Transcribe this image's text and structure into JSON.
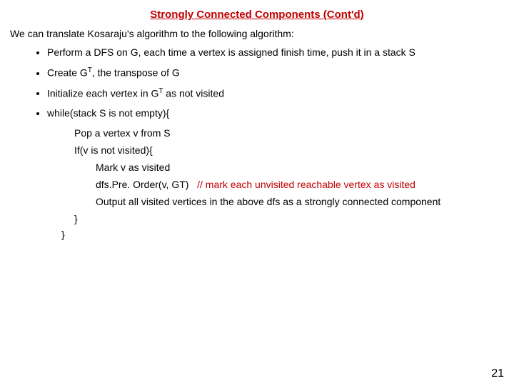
{
  "title": "Strongly Connected Components (Cont'd)",
  "intro": "We can translate Kosaraju's algorithm to the following algorithm:",
  "bullets": {
    "b1": "Perform a DFS on G, each time a vertex is assigned finish time, push it in a stack S",
    "b2_pre": "Create G",
    "b2_sup": "T",
    "b2_post": ", the transpose of G",
    "b3_pre": "Initialize each vertex in G",
    "b3_sup": "T",
    "b3_post": " as not visited",
    "b4": "while(stack S is not empty){"
  },
  "inner": {
    "pop": "Pop a vertex v from S",
    "ifline": "If(v is not visited){",
    "mark": "Mark v as visited",
    "dfs_code": "dfs.Pre. Order(v, GT)",
    "dfs_comment": "// mark each unvisited reachable vertex as visited",
    "output": "Output all visited vertices in the above dfs as a strongly connected component",
    "brace_inner": "}",
    "brace_outer": "}"
  },
  "pagenum": "21"
}
